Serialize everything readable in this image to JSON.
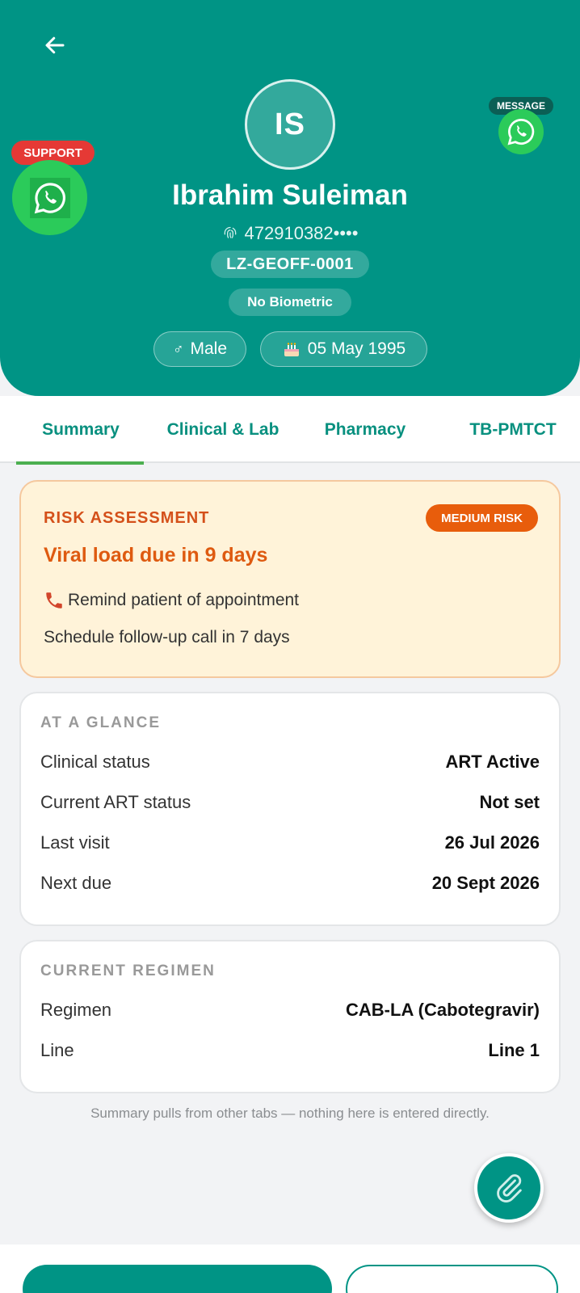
{
  "patient": {
    "initials": "IS",
    "name": "Ibrahim Suleiman",
    "id_masked": "472910382••••",
    "code": "LZ-GEOFF-0001",
    "biometric": "No Biometric",
    "gender": "Male",
    "gender_symbol": "♂",
    "dob": "05 May 1995"
  },
  "actions": {
    "support_label": "SUPPORT",
    "message_label": "MESSAGE",
    "icons": {
      "back": "arrow-left-icon",
      "support": "whatsapp-icon",
      "message": "whatsapp-icon",
      "fingerprint": "fingerprint-icon",
      "birthday": "cake-icon",
      "attach": "paperclip-icon",
      "phone": "phone-icon"
    }
  },
  "tabs": [
    {
      "label": "Summary",
      "active": true
    },
    {
      "label": "Clinical & Lab",
      "active": false
    },
    {
      "label": "Pharmacy",
      "active": false
    },
    {
      "label": "TB-PMTCT",
      "active": false
    }
  ],
  "risk": {
    "title": "RISK ASSESSMENT",
    "badge": "MEDIUM RISK",
    "headline": "Viral load due in 9 days",
    "line1": "Remind patient of appointment",
    "line2": "Schedule follow-up call in 7 days"
  },
  "glance": {
    "title": "AT A GLANCE",
    "rows": [
      {
        "label": "Clinical status",
        "value": "ART Active"
      },
      {
        "label": "Current ART status",
        "value": "Not set"
      },
      {
        "label": "Last visit",
        "value": "26 Jul 2026"
      },
      {
        "label": "Next due",
        "value": "20 Sept 2026"
      }
    ]
  },
  "regimen": {
    "title": "CURRENT REGIMEN",
    "rows": [
      {
        "label": "Regimen",
        "value": "CAB-LA (Cabotegravir)"
      },
      {
        "label": "Line",
        "value": "Line 1"
      }
    ]
  },
  "footnote": "Summary pulls from other tabs — nothing here is entered directly.",
  "colors": {
    "primary": "#009485",
    "risk_accent": "#e85d0c",
    "risk_bg": "#fff3d9",
    "whatsapp": "#2bcb5a",
    "support_badge": "#e53935",
    "tab_indicator": "#4caf50"
  }
}
